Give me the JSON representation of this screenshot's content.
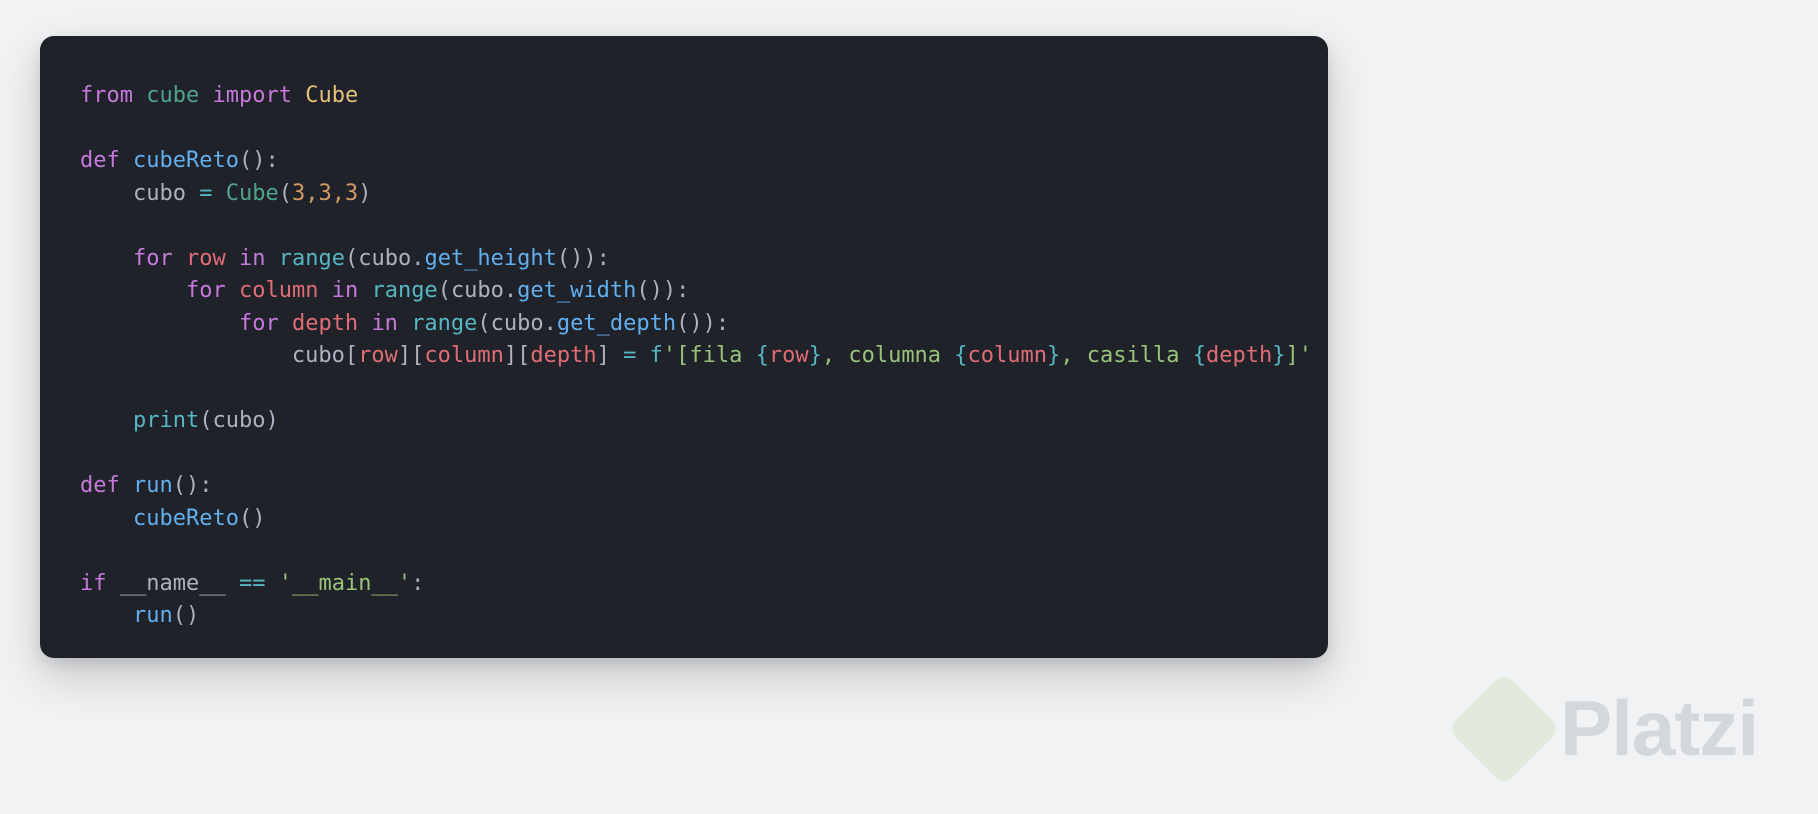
{
  "code": {
    "line1": {
      "from": "from",
      "mod": "cube",
      "import": "import",
      "cls": "Cube"
    },
    "line3": {
      "def": "def",
      "fn": "cubeReto",
      "parens": "():"
    },
    "line4": {
      "var": "cubo",
      "eq": "=",
      "cls": "Cube",
      "args": "3,3,3"
    },
    "line6": {
      "for": "for",
      "v": "row",
      "in": "in",
      "range": "range",
      "obj": "cubo",
      "m": "get_height"
    },
    "line7": {
      "for": "for",
      "v": "column",
      "in": "in",
      "range": "range",
      "obj": "cubo",
      "m": "get_width"
    },
    "line8": {
      "for": "for",
      "v": "depth",
      "in": "in",
      "range": "range",
      "obj": "cubo",
      "m": "get_depth"
    },
    "line9": {
      "obj": "cubo",
      "row": "row",
      "col": "column",
      "dep": "depth",
      "eq": "=",
      "f": "f",
      "s1": "'[fila ",
      "b1o": "{",
      "r": "row",
      "b1c": "}",
      "s2": ", columna ",
      "b2o": "{",
      "c": "column",
      "b2c": "}",
      "s3": ", casilla ",
      "b3o": "{",
      "d": "depth",
      "b3c": "}",
      "s4": "]'"
    },
    "line11": {
      "print": "print",
      "arg": "cubo"
    },
    "line13": {
      "def": "def",
      "fn": "run",
      "parens": "():"
    },
    "line14": {
      "call": "cubeReto"
    },
    "line16": {
      "if": "if",
      "name": "__name__",
      "eq": "==",
      "str": "'__main__'",
      "colon": ":"
    },
    "line17": {
      "call": "run"
    }
  },
  "watermark": {
    "brand": "Platzi"
  }
}
